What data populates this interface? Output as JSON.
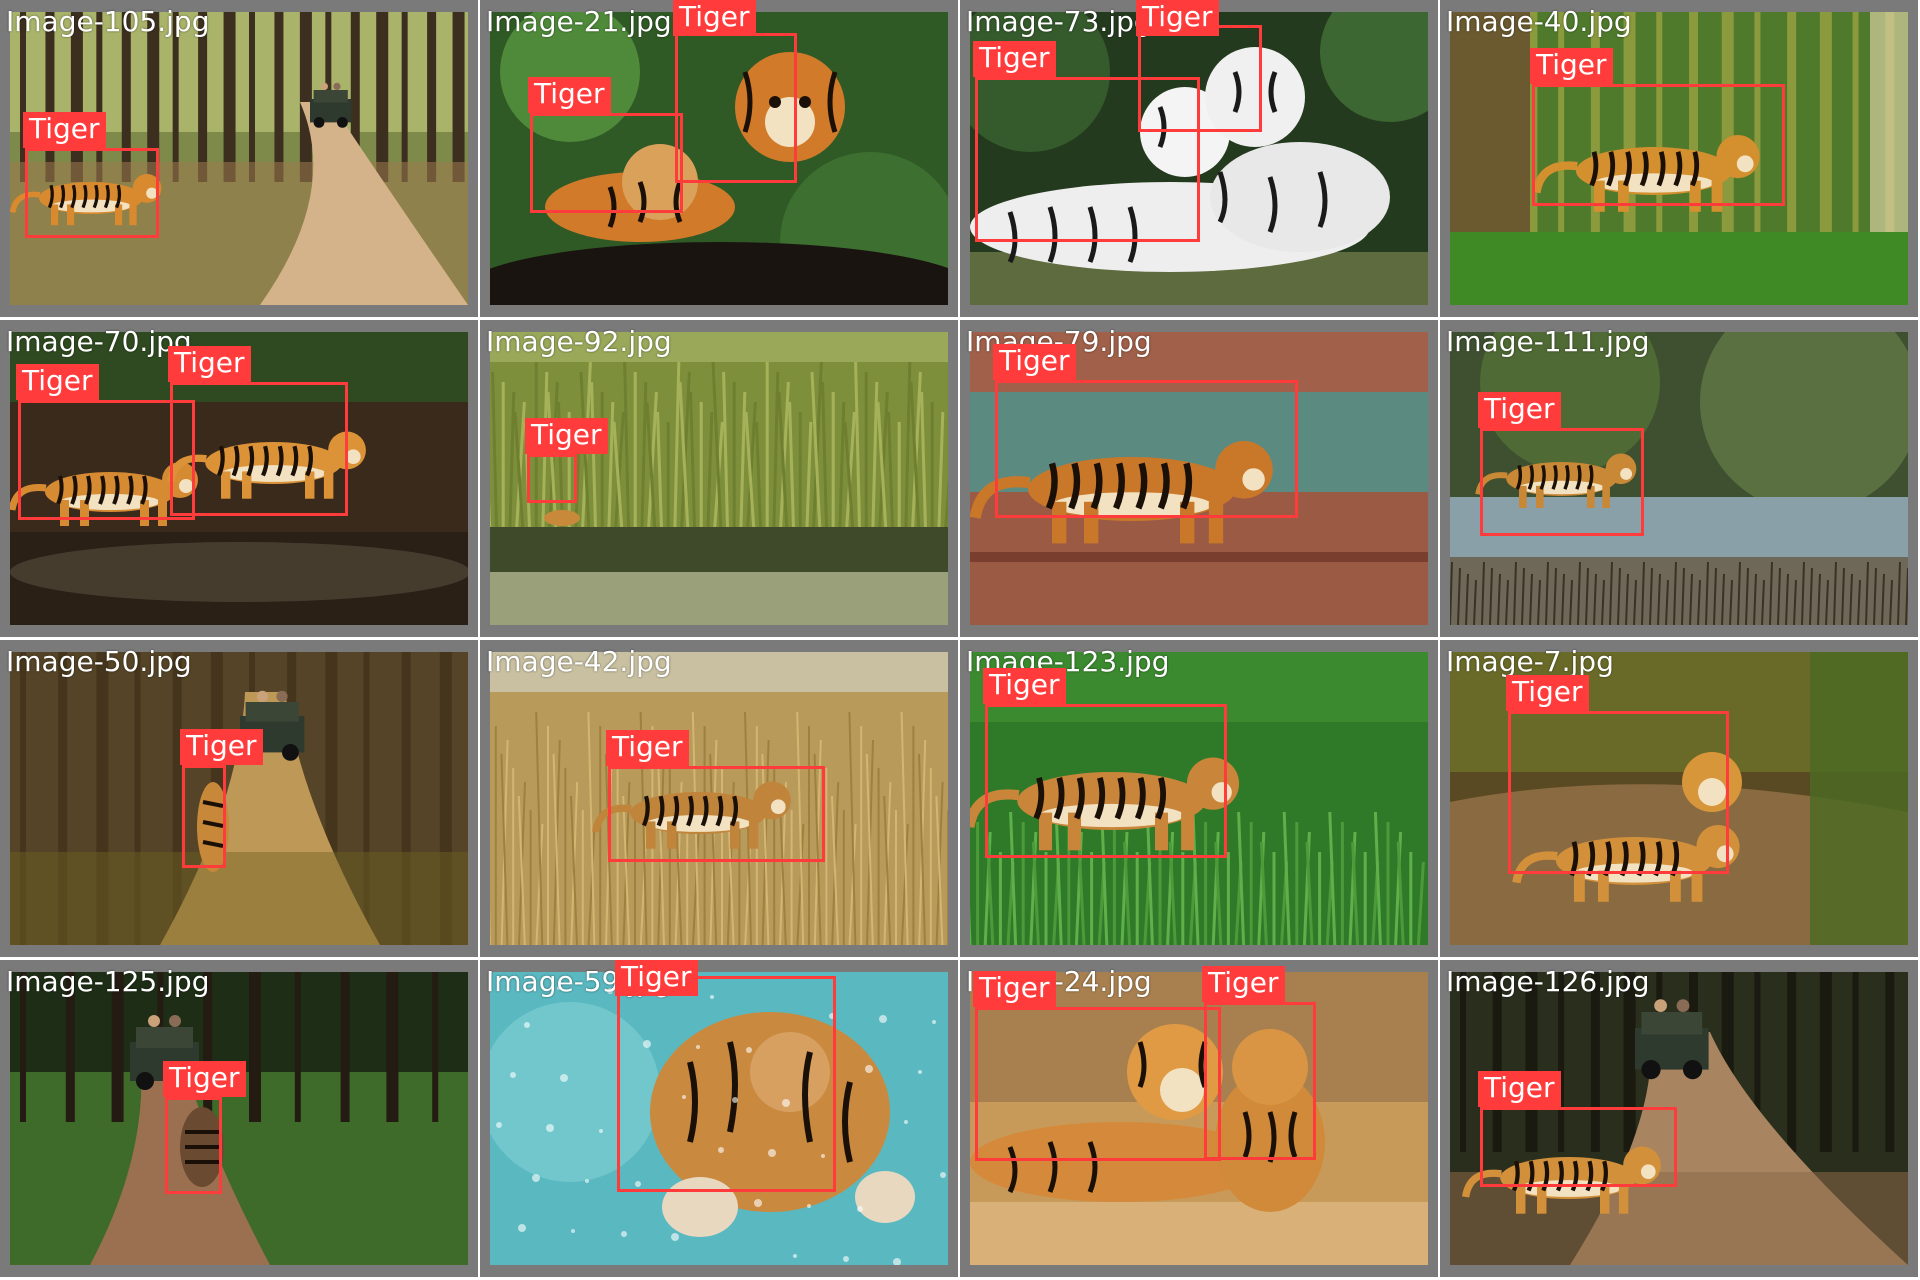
{
  "grid": {
    "tiles": [
      {
        "filename": "Image-105.jpg",
        "scene": "forest-road-jeep",
        "detections": [
          {
            "label": "Tiger"
          }
        ]
      },
      {
        "filename": "Image-21.jpg",
        "scene": "cubs-greenery",
        "detections": [
          {
            "label": "Tiger"
          },
          {
            "label": "Tiger"
          }
        ]
      },
      {
        "filename": "Image-73.jpg",
        "scene": "white-tigers",
        "detections": [
          {
            "label": "Tiger"
          },
          {
            "label": "Tiger"
          }
        ]
      },
      {
        "filename": "Image-40.jpg",
        "scene": "bamboo-grove",
        "detections": [
          {
            "label": "Tiger"
          }
        ]
      },
      {
        "filename": "Image-70.jpg",
        "scene": "pair-in-stream",
        "detections": [
          {
            "label": "Tiger"
          },
          {
            "label": "Tiger"
          }
        ]
      },
      {
        "filename": "Image-92.jpg",
        "scene": "tall-grass-waterhole",
        "detections": [
          {
            "label": "Tiger"
          }
        ]
      },
      {
        "filename": "Image-79.jpg",
        "scene": "enclosure-pool",
        "detections": [
          {
            "label": "Tiger"
          }
        ]
      },
      {
        "filename": "Image-111.jpg",
        "scene": "river-bank",
        "detections": [
          {
            "label": "Tiger"
          }
        ]
      },
      {
        "filename": "Image-50.jpg",
        "scene": "dusty-forest-track",
        "detections": [
          {
            "label": "Tiger"
          }
        ]
      },
      {
        "filename": "Image-42.jpg",
        "scene": "dry-grassland",
        "detections": [
          {
            "label": "Tiger"
          }
        ]
      },
      {
        "filename": "Image-123.jpg",
        "scene": "lush-grass",
        "detections": [
          {
            "label": "Tiger"
          }
        ]
      },
      {
        "filename": "Image-7.jpg",
        "scene": "resting-on-trail",
        "detections": [
          {
            "label": "Tiger"
          }
        ]
      },
      {
        "filename": "Image-125.jpg",
        "scene": "grassy-track-jeep",
        "detections": [
          {
            "label": "Tiger"
          }
        ]
      },
      {
        "filename": "Image-59.jpg",
        "scene": "underwater",
        "detections": [
          {
            "label": "Tiger"
          }
        ]
      },
      {
        "filename": "Image-24.jpg",
        "scene": "mother-and-cub",
        "detections": [
          {
            "label": "Tiger"
          },
          {
            "label": "Tiger"
          }
        ]
      },
      {
        "filename": "Image-126.jpg",
        "scene": "crossing-road-jeep",
        "detections": [
          {
            "label": "Tiger"
          }
        ]
      }
    ]
  },
  "colors": {
    "box": "#ff3b3b",
    "label_text": "#ffffff",
    "tile_border": "#7a7a7a"
  }
}
